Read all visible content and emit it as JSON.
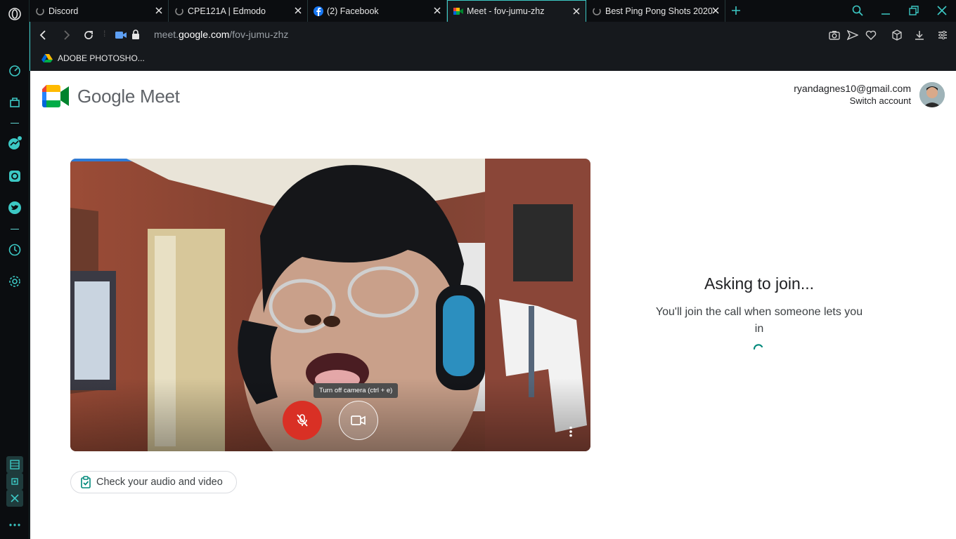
{
  "tabs": [
    {
      "title": "Discord",
      "icon": "loading-icon",
      "active": false
    },
    {
      "title": "CPE121A | Edmodo",
      "icon": "loading-icon",
      "active": false
    },
    {
      "title": "(2) Facebook",
      "icon": "facebook-icon",
      "active": false
    },
    {
      "title": "Meet - fov-jumu-zhz",
      "icon": "google-meet-icon",
      "active": true
    },
    {
      "title": "Best Ping Pong Shots 2020",
      "icon": "loading-icon",
      "active": false
    }
  ],
  "address": {
    "url_host_prefix": "meet.",
    "url_host": "google.com",
    "url_path": "/fov-jumu-zhz"
  },
  "bookmarks": [
    {
      "label": "ADOBE PHOTOSHO..."
    }
  ],
  "meet": {
    "brand": "Google Meet",
    "account_email": "ryandagnes10@gmail.com",
    "switch_account": "Switch account",
    "tooltip": "Turn off camera (ctrl + e)",
    "check_audio_video": "Check your audio and video",
    "join_title": "Asking to join...",
    "join_subtitle": "You'll join the call when someone lets you in",
    "mic_state": "muted"
  },
  "colors": {
    "accent": "#3cc8c4",
    "mic_off": "#ea4335",
    "meet_green": "#00897b"
  }
}
